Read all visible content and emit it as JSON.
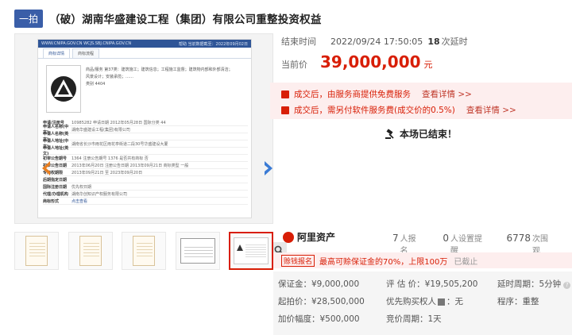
{
  "title": {
    "badge": "一拍",
    "text": "（破）湖南华盛建设工程（集团）有限公司重整投资权益"
  },
  "doc": {
    "topbar_left": "WWW.CNIPA.GOV.CN  WCJS.SBJ.CNIPA.GOV.CN",
    "topbar_right": "帮助    当前数据截至：2022年09月02日",
    "tabs": [
      "商标详情",
      "商标流程"
    ],
    "info": [
      "商品/服务   第37类：建筑施工；建筑信息；工程施工监督；建筑物内部和外部清洁；",
      "风景设计；安装承揽；……",
      "类别    4404"
    ],
    "rows": [
      {
        "k": "申请/注册号",
        "v": "10985282    申请日期    2012年05月28日    国际分类  44"
      },
      {
        "k": "申请人名称(中文)",
        "v": "湖南华盛建设工程(集团)有限公司"
      },
      {
        "k": "申请人名称(英文)",
        "v": ""
      },
      {
        "k": "申请人地址(中文)",
        "v": "湖南省长沙市雨花区雨花亭街道二段30号华盛建设大厦"
      },
      {
        "k": "申请人地址(英文)",
        "v": ""
      },
      {
        "k": "初审公告期号",
        "v": "1364    注册公告期号   1376    是否共有商标  否"
      },
      {
        "k": "初审公告日期",
        "v": "2013年06月20日    注册公告日期   2013年09月21日    商标类型  一般"
      },
      {
        "k": "专用权期限",
        "v": "2013年09月21日 至 2023年09月20日"
      },
      {
        "k": "后期指定日期",
        "v": ""
      },
      {
        "k": "国际注册日期",
        "v": "    优先权日期"
      },
      {
        "k": "代理/办理机构",
        "v": "湖南华创知识产权服务有限公司"
      },
      {
        "k": "商标形式",
        "v": "点击查看"
      }
    ]
  },
  "auction": {
    "end_label": "结束时间",
    "end_time": "2022/09/24 17:50:05",
    "delay_count": "18",
    "delay_unit": "次延时",
    "price_label": "当前价",
    "price": "39,000,000",
    "price_unit": "元",
    "notices": [
      {
        "text": "成交后，由服务商提供免费服务",
        "link": "查看详情 >>"
      },
      {
        "text": "成交后，需另付软件服务费(成交价的0.5%)",
        "link": "查看详情 >>"
      }
    ],
    "ended_text": "本场已结束！"
  },
  "info": {
    "logo_text": "阿里资产",
    "stats": [
      {
        "n": "7",
        "label": "人报名"
      },
      {
        "n": "0",
        "label": "人设置提醒"
      },
      {
        "n": "6778",
        "label": "次围观"
      }
    ],
    "deposit_tag": "赊钱报名",
    "deposit_msg": "最高可赊保证金的70%，上限100万",
    "deposit_status": "已截止",
    "grid": {
      "deposit": "保证金：¥9,000,000",
      "appraisal": "评 估 价：¥19,505,200",
      "delay": "延时周期：5分钟",
      "start": "起拍价：¥28,500,000",
      "priority_label": "优先购买权人",
      "priority_val": "：无",
      "procedure": "程序：重整",
      "increment": "加价幅度：¥500,000",
      "cycle": "竞价周期：1天"
    }
  },
  "colors": {
    "accent": "#d81e06",
    "brand_blue": "#3a5ea8"
  }
}
